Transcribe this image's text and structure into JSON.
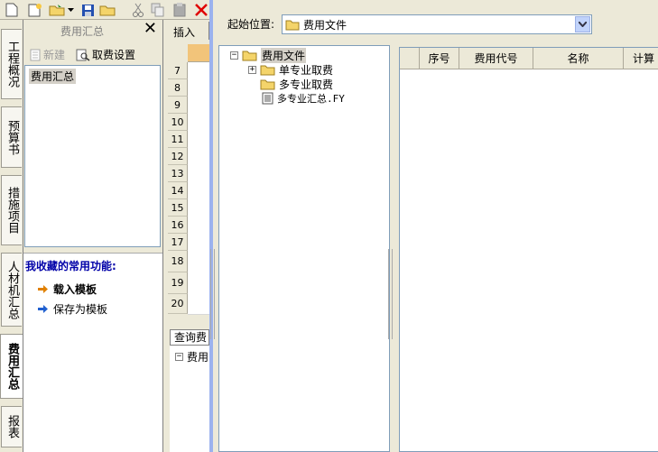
{
  "left_panel": {
    "title": "费用汇总",
    "new_label": "新建",
    "settings_label": "取费设置",
    "list_item": "费用汇总",
    "favorites_title": "我收藏的常用功能:",
    "favorites": [
      "载入模板",
      "保存为模板"
    ]
  },
  "vertical_tabs": [
    "工程概况",
    "预算书",
    "措施项目",
    "人材机汇总",
    "费用汇总",
    "报表"
  ],
  "active_tab": "费用汇总",
  "grid": {
    "insert_label": "插入",
    "rows": [
      "7",
      "8",
      "9",
      "10",
      "11",
      "12",
      "13",
      "14",
      "15",
      "16",
      "17",
      "18",
      "19",
      "20"
    ],
    "query_tab": "查询费",
    "query_tree_item": "费用"
  },
  "dialog": {
    "origin_label": "起始位置:",
    "origin_value": "费用文件",
    "tree": [
      {
        "label": "费用文件",
        "type": "folder",
        "expander": "−"
      },
      {
        "label": "单专业取费",
        "type": "folder",
        "expander": "+"
      },
      {
        "label": "多专业取费",
        "type": "folder",
        "expander": ""
      },
      {
        "label": "多专业汇总.FY",
        "type": "file",
        "expander": ""
      }
    ],
    "columns": [
      "序号",
      "费用代号",
      "名称",
      "计算"
    ]
  },
  "colors": {
    "folder": "#f4d46a",
    "accent_blue": "#0000a8",
    "arrow_orange": "#e08000",
    "arrow_blue": "#2060d0"
  }
}
